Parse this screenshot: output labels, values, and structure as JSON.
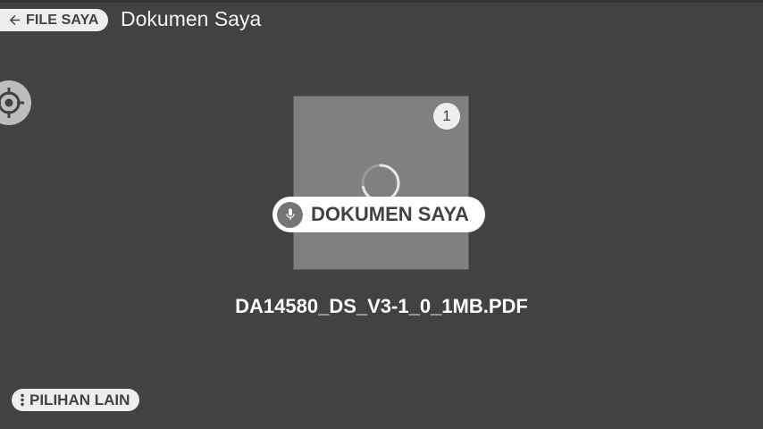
{
  "header": {
    "back_label": "FILE SAYA",
    "back_icon": "arrow-left-icon",
    "title": "Dokumen Saya"
  },
  "location_button": {
    "icon": "crosshair-icon"
  },
  "document": {
    "page_count_badge": "1",
    "loading_icon": "loading-spinner-icon",
    "file_name": "DA14580_DS_V3-1_0_1MB.PDF"
  },
  "voice_hint": {
    "icon": "microphone-icon",
    "label": "DOKUMEN SAYA"
  },
  "footer": {
    "more_label": "PILIHAN LAIN",
    "more_icon": "more-vertical-icon"
  },
  "colors": {
    "background": "#424242",
    "pill": "#eeeeee",
    "thumbnail": "#808080",
    "accent_dark": "#424242"
  }
}
